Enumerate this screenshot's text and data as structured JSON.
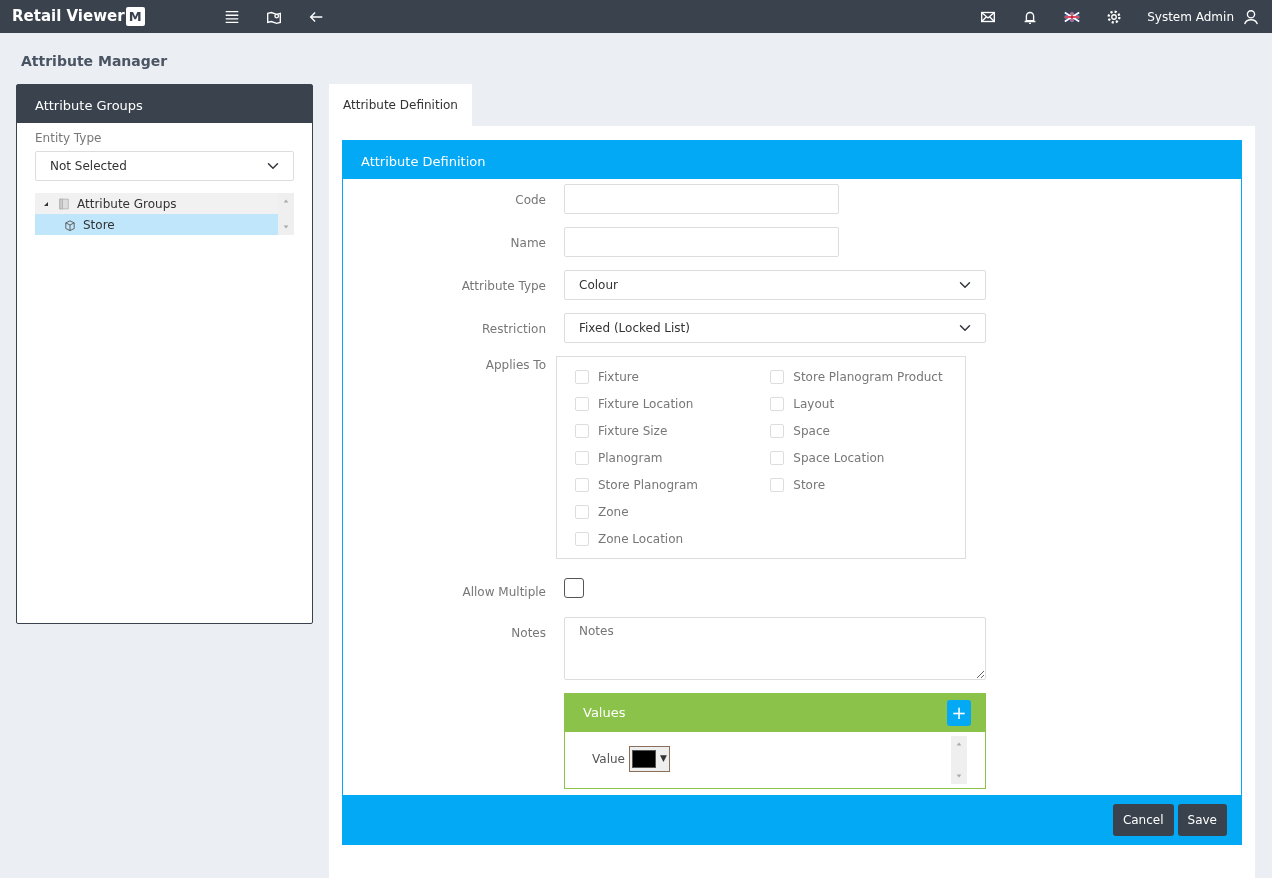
{
  "app": {
    "name": "Retail Viewer",
    "logo_mark": "M",
    "user": "System Admin"
  },
  "page_title": "Attribute Manager",
  "sidebar": {
    "title": "Attribute Groups",
    "entity_type": {
      "label": "Entity Type",
      "value": "Not Selected"
    },
    "tree": [
      {
        "label": "Attribute Groups",
        "expanded": true,
        "selected": false,
        "children": [
          {
            "label": "Store",
            "selected": true
          }
        ]
      }
    ]
  },
  "tabs": [
    {
      "label": "Attribute Definition",
      "selected": true
    }
  ],
  "form": {
    "title": "Attribute Definition",
    "fields": [
      {
        "kind": "text",
        "label": "Code"
      },
      {
        "kind": "text",
        "label": "Name"
      },
      {
        "kind": "select",
        "label": "Attribute Type",
        "value": "Colour"
      },
      {
        "kind": "select",
        "label": "Restriction",
        "value": "Fixed (Locked List)"
      },
      {
        "kind": "checklist",
        "label": "Applies To",
        "columns": [
          [
            {
              "label": "Fixture",
              "checked": false
            },
            {
              "label": "Fixture Location",
              "checked": false
            },
            {
              "label": "Fixture Size",
              "checked": false
            },
            {
              "label": "Planogram",
              "checked": false
            },
            {
              "label": "Store Planogram",
              "checked": false
            },
            {
              "label": "Zone",
              "checked": false
            },
            {
              "label": "Zone Location",
              "checked": false
            }
          ],
          [
            {
              "label": "Store Planogram Product",
              "checked": false
            },
            {
              "label": "Layout",
              "checked": false
            },
            {
              "label": "Space",
              "checked": false
            },
            {
              "label": "Space Location",
              "checked": false
            },
            {
              "label": "Store",
              "checked": false
            }
          ]
        ]
      },
      {
        "kind": "checkbox",
        "label": "Allow Multiple",
        "checked": false
      },
      {
        "kind": "textarea",
        "label": "Notes",
        "placeholder": "Notes"
      }
    ],
    "values": {
      "title": "Values",
      "add": "+",
      "rows": [
        {
          "label": "Value",
          "color": "#000000",
          "arrow": "▼"
        }
      ]
    },
    "buttons": [
      {
        "label": "Cancel"
      },
      {
        "label": "Save"
      }
    ]
  }
}
